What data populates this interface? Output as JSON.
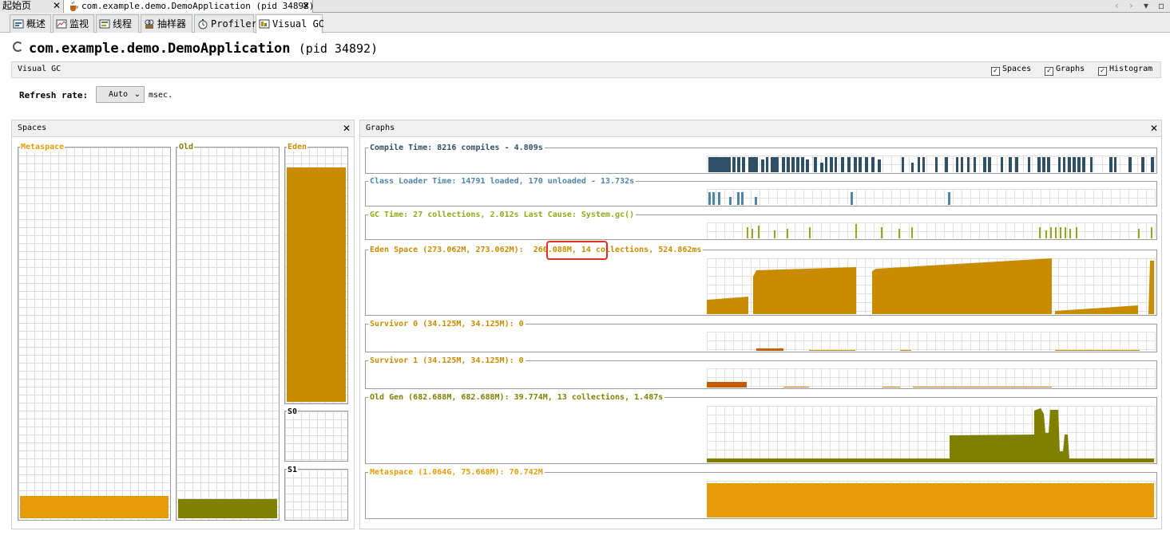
{
  "doc_tabs": [
    {
      "label": "起始页"
    },
    {
      "label": "com.example.demo.DemoApplication (pid 34892)"
    }
  ],
  "sub_tabs": [
    {
      "label": "概述"
    },
    {
      "label": "监视"
    },
    {
      "label": "线程"
    },
    {
      "label": "抽样器"
    },
    {
      "label": "Profiler"
    },
    {
      "label": "Visual GC"
    }
  ],
  "app": {
    "name": "com.example.demo.DemoApplication",
    "pid": "(pid 34892)"
  },
  "visual_gc": {
    "label": "Visual GC",
    "toggles": [
      {
        "label": "Spaces",
        "checked": true
      },
      {
        "label": "Graphs",
        "checked": true
      },
      {
        "label": "Histogram",
        "checked": true
      }
    ]
  },
  "refresh": {
    "label": "Refresh rate:",
    "value": "Auto",
    "unit": "msec."
  },
  "spaces_panel": {
    "title": "Spaces",
    "metaspace": {
      "label": "Metaspace",
      "color": "#e69c0a"
    },
    "old": {
      "label": "Old",
      "color": "#808000"
    },
    "eden": {
      "label": "Eden",
      "color": "#c98c00"
    },
    "s0": {
      "label": "S0"
    },
    "s1": {
      "label": "S1"
    }
  },
  "graphs_panel": {
    "title": "Graphs",
    "graphs": [
      {
        "key": "compile",
        "label": "Compile Time: 8216 compiles - 4.809s",
        "color": "#2f5066"
      },
      {
        "key": "classloader",
        "label": "Class Loader Time: 14791 loaded, 170 unloaded - 13.732s",
        "color": "#4d86a8"
      },
      {
        "key": "gc",
        "label": "GC Time: 27 collections, 2.012s  Last Cause: System.gc()",
        "color": "#93a81a"
      },
      {
        "key": "eden",
        "label_prefix": "Eden Space (273.062M, 273.062M):",
        "label_highlight": "260.088M,",
        "label_suffix": "14 collections, 524.862ms",
        "color": "#c98c00"
      },
      {
        "key": "s0",
        "label": "Survivor 0 (34.125M, 34.125M): 0",
        "color": "#c98c00"
      },
      {
        "key": "s1",
        "label": "Survivor 1 (34.125M, 34.125M): 0",
        "color": "#c98c00"
      },
      {
        "key": "old",
        "label": "Old Gen (682.688M, 682.688M): 39.774M, 13 collections, 1.487s",
        "color": "#808000"
      },
      {
        "key": "metaspace",
        "label": "Metaspace (1.064G, 75.668M): 70.742M",
        "color": "#e69c0a"
      }
    ]
  },
  "colors": {
    "highlight": "#e03020"
  }
}
